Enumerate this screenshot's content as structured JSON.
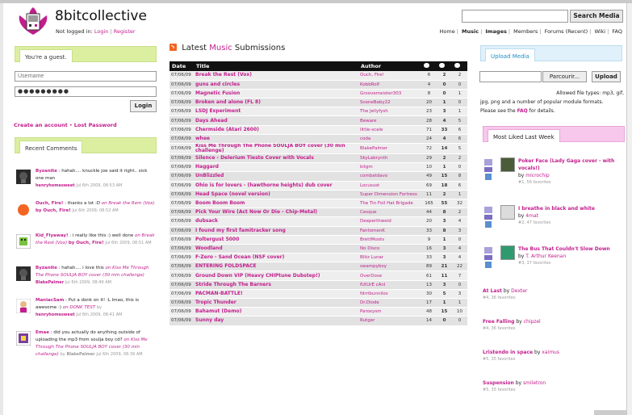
{
  "header": {
    "site_name": "8bitcollective",
    "not_logged_in": "Not logged in:",
    "login": "Login",
    "sep": "|",
    "register": "Register",
    "search_button": "Search Media",
    "nav": [
      "Home",
      "Music",
      "Images",
      "Members",
      "Forums (Recent)",
      "Wiki",
      "FAQ"
    ]
  },
  "guest": {
    "tab_label": "You're a guest.",
    "username_placeholder": "Username",
    "password_value": "●●●●●●●●●",
    "login_button": "Login",
    "create_account": "Create an account",
    "bullet": "•",
    "lost_password": "Lost Password"
  },
  "recent": {
    "tab_label": "Recent Comments",
    "comments": [
      {
        "user": "Byzanite",
        "text": ": hahah.... knuckle joe said it right.. sick one man",
        "link": "",
        "by": "",
        "meta_user": "henryhomesweet",
        "meta_date": "Jul 6th 2009, 08:53 AM"
      },
      {
        "user": "Ouch, Fire!",
        "text": ": thanks a lot :D",
        "link": "on Break the Rem (Vox)",
        "by": "by Ouch, Fire!",
        "meta_user": "",
        "meta_date": "Jul 6th 2009, 08:52 AM"
      },
      {
        "user": "Kid_Flyaway!",
        "text": ": i really like this :) well done",
        "link": "on Break the Rest (Vox)",
        "by": "by Ouch, Fire!",
        "meta_user": "",
        "meta_date": "Jul 6th 2009, 08:51 AM"
      },
      {
        "user": "Byzanite",
        "text": ": hahah.... i love this",
        "link": "on Kiss Me Through The Phone SOULJA BOY cover (30 min challenge)",
        "by": "",
        "meta_user": "BlakePalmer",
        "meta_date": "Jul 6th 2009, 08:49 AM"
      },
      {
        "user": "ManiacSam",
        "text": ": Put a donk on it! :L lmao, this is awesome :)",
        "link": "on DONK TEST",
        "by": "by",
        "meta_user": "henryhomesweet",
        "meta_date": "Jul 6th 2009, 08:41 AM"
      },
      {
        "user": "Emae",
        "text": ": did you actually do anything outside of uploading the mp3 from soulja boy cd?",
        "link": "on Kiss Me Through The Phone SOULJA BOY cover (30 min challenge)",
        "by": "by",
        "meta_user": "BlakePalmer",
        "meta_date": "Jul 6th 2009, 08:39 AM"
      }
    ]
  },
  "latest": {
    "word1": "Latest",
    "word2": "Music",
    "word3": "Submissions",
    "columns": {
      "date": "Date",
      "title": "Title",
      "author": "Author"
    },
    "rows": [
      {
        "date": "07/06/09",
        "title": "Break the Rest (Vox)",
        "author": "Ouch, Fire!",
        "plays": "6",
        "comments": "2",
        "favs": "2"
      },
      {
        "date": "07/06/09",
        "title": "guns and circles",
        "author": "KobbRolf",
        "plays": "4",
        "comments": "0",
        "favs": "0"
      },
      {
        "date": "07/06/09",
        "title": "Magnetic Fusion",
        "author": "Groovemeister303",
        "plays": "8",
        "comments": "0",
        "favs": "1"
      },
      {
        "date": "07/06/09",
        "title": "Broken and alone (FL 8)",
        "author": "SceneBaby22",
        "plays": "20",
        "comments": "1",
        "favs": "0"
      },
      {
        "date": "07/06/09",
        "title": "LSDJ Experiment",
        "author": "The Jellyfysh",
        "plays": "23",
        "comments": "3",
        "favs": "1"
      },
      {
        "date": "07/06/09",
        "title": "Days Ahead",
        "author": "Beware",
        "plays": "28",
        "comments": "4",
        "favs": "5"
      },
      {
        "date": "07/06/09",
        "title": "Chermside (Atari 2600)",
        "author": "little-scale",
        "plays": "71",
        "comments": "33",
        "favs": "6"
      },
      {
        "date": "07/06/09",
        "title": "whee",
        "author": "coda",
        "plays": "24",
        "comments": "4",
        "favs": "6"
      },
      {
        "date": "07/06/09",
        "title": "Kiss Me Through The Phone SOULJA BOY cover (30 min challenge)",
        "author": "BlakePalmer",
        "plays": "72",
        "comments": "14",
        "favs": "5"
      },
      {
        "date": "07/06/09",
        "title": "Silence - Delerium Tiesto Cover with Vocals",
        "author": "SkyLabrynth",
        "plays": "29",
        "comments": "2",
        "favs": "2"
      },
      {
        "date": "07/06/09",
        "title": "Haggard",
        "author": "kitgm",
        "plays": "10",
        "comments": "1",
        "favs": "0"
      },
      {
        "date": "07/06/09",
        "title": "UnBlizzled",
        "author": "combatdavo",
        "plays": "49",
        "comments": "15",
        "favs": "8"
      },
      {
        "date": "07/06/09",
        "title": "Ohio is for lovers - (hawthorne heights) dub cover",
        "author": "Locusust",
        "plays": "69",
        "comments": "18",
        "favs": "6"
      },
      {
        "date": "07/06/09",
        "title": "Head Space (novel version)",
        "author": "Super Dimension Fortress",
        "plays": "11",
        "comments": "2",
        "favs": "1"
      },
      {
        "date": "07/06/09",
        "title": "Boom Boom Boom",
        "author": "The Tin Foil Hat Brigade",
        "plays": "165",
        "comments": "55",
        "favs": "32"
      },
      {
        "date": "07/06/09",
        "title": "Pick Your Wire (Act Now Or Die - Chip-Metal)",
        "author": "Cesque",
        "plays": "44",
        "comments": "8",
        "favs": "2"
      },
      {
        "date": "07/06/09",
        "title": "dubsack",
        "author": "Deeperthweid",
        "plays": "20",
        "comments": "3",
        "favs": "4"
      },
      {
        "date": "07/06/09",
        "title": "I found my first famitracker song",
        "author": "FantomenK",
        "plays": "33",
        "comments": "8",
        "favs": "3"
      },
      {
        "date": "07/06/09",
        "title": "Poltergust 5000",
        "author": "BrettMoots",
        "plays": "9",
        "comments": "1",
        "favs": "0"
      },
      {
        "date": "07/06/09",
        "title": "Woodland",
        "author": "No Disco",
        "plays": "16",
        "comments": "3",
        "favs": "4"
      },
      {
        "date": "07/06/09",
        "title": "F-Zero - Sand Ocean (NSF cover)",
        "author": "Blitz Lunar",
        "plays": "33",
        "comments": "3",
        "favs": "4"
      },
      {
        "date": "07/06/09",
        "title": "ENTERING FOLDSPACE",
        "author": "swampyboy",
        "plays": "89",
        "comments": "21",
        "favs": "22"
      },
      {
        "date": "07/06/09",
        "title": "Ground Down VIP (Heavy CHIPtune Dubstep!)",
        "author": "OverDose",
        "plays": "61",
        "comments": "11",
        "favs": "7"
      },
      {
        "date": "07/06/09",
        "title": "Stride Through The Barners",
        "author": "fUtUrE cAnl",
        "plays": "13",
        "comments": "3",
        "favs": "0"
      },
      {
        "date": "07/06/09",
        "title": "PACMAN-BATTLE!",
        "author": "fdrribunnilos",
        "plays": "30",
        "comments": "5",
        "favs": "3"
      },
      {
        "date": "07/06/09",
        "title": "Tropic Thunder",
        "author": "Dr.Diode",
        "plays": "17",
        "comments": "1",
        "favs": "1"
      },
      {
        "date": "07/06/09",
        "title": "Bahamut (Demo)",
        "author": "Paroxysm",
        "plays": "48",
        "comments": "15",
        "favs": "10"
      },
      {
        "date": "07/06/09",
        "title": "Sunny day",
        "author": "Rutger",
        "plays": "14",
        "comments": "0",
        "favs": "0"
      }
    ]
  },
  "upload": {
    "tab_label": "Upload Media",
    "browse": "Parcourir...",
    "button": "Upload",
    "info1": "Allowed file types: mp3, gif,",
    "info2": "jpg, png and a number of popular module formats.",
    "info3a": "Please see the",
    "info3b": "FAQ",
    "info3c": "for details."
  },
  "most_liked": {
    "tab_label": "Most Liked Last Week",
    "items": [
      {
        "title": "Poker Face (Lady Gaga cover - with vocals!)",
        "by": "by",
        "author": "microchip",
        "favs": "#1, 56 favorites"
      },
      {
        "title": "I breathe in black and white",
        "by": "by",
        "author": "4mat",
        "favs": "#2, 47 favorites"
      },
      {
        "title": "The Bus That Couldn't Slow Down",
        "by": "by",
        "author": "T. Arthur Keenan",
        "favs": "#3, 37 favorites"
      }
    ],
    "simple": [
      {
        "title": "At Last",
        "by": "by",
        "author": "Dexter",
        "favs": "#4, 36 favorites"
      },
      {
        "title": "Free Falling",
        "by": "by",
        "author": "chipzel",
        "favs": "#4, 36 favorites"
      },
      {
        "title": "Lristendo in space",
        "by": "by",
        "author": "xaimus",
        "favs": "#5, 35 favorites"
      },
      {
        "title": "Suspension",
        "by": "by",
        "author": "smiletron",
        "favs": "#5, 35 favorites"
      }
    ]
  }
}
